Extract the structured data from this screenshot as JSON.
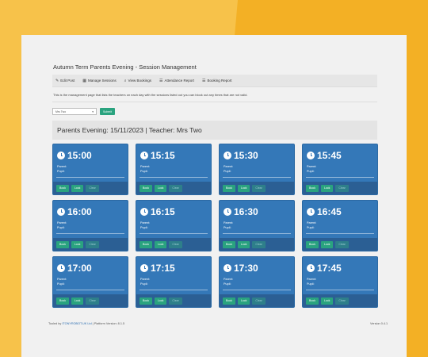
{
  "page": {
    "title": "Autumn Term Parents Evening - Session Management",
    "description": "This is the management page that lists the teachers on each day with the sessions listed out you can block out any times that are not valid."
  },
  "toolbar": {
    "items": [
      {
        "label": "Edit Post",
        "icon": "pencil-icon"
      },
      {
        "label": "Manage Sessions",
        "icon": "calendar-icon"
      },
      {
        "label": "View Bookings",
        "icon": "search-icon"
      },
      {
        "label": "Attendance Report",
        "icon": "list-icon"
      },
      {
        "label": "Booking Report",
        "icon": "list-icon"
      }
    ]
  },
  "filter": {
    "selected": "Mrs Two",
    "submit_label": "Submit"
  },
  "panel": {
    "heading": "Parents Evening: 15/11/2023 | Teacher: Mrs Two"
  },
  "card_labels": {
    "parent": "Parent:",
    "pupil": "Pupil:",
    "book": "Book",
    "lock": "Lock",
    "clear": "Clear"
  },
  "sessions": [
    {
      "time": "15:00"
    },
    {
      "time": "15:15"
    },
    {
      "time": "15:30"
    },
    {
      "time": "15:45"
    },
    {
      "time": "16:00"
    },
    {
      "time": "16:15"
    },
    {
      "time": "16:30"
    },
    {
      "time": "16:45"
    },
    {
      "time": "17:00"
    },
    {
      "time": "17:15"
    },
    {
      "time": "17:30"
    },
    {
      "time": "17:45"
    }
  ],
  "footer": {
    "prefix": "Tooled by",
    "link": "ITONYROBOT.UK Ltd",
    "suffix": "| Platform Version: 8.1.5",
    "version": "Version 0.4.1"
  },
  "colors": {
    "card": "#3478b8",
    "card_footer": "#2b5f94",
    "button": "#2aa37f",
    "background": "#f5b42a"
  }
}
